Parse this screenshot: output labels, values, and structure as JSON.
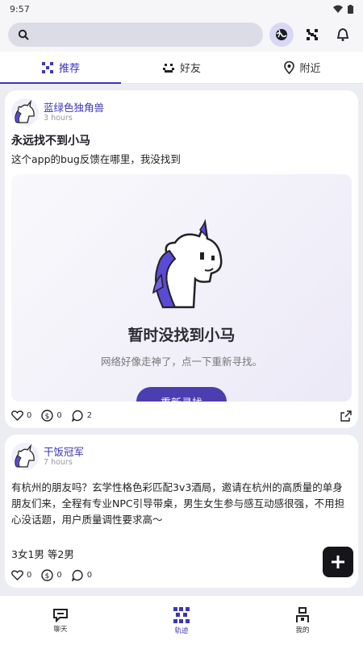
{
  "status_bar": {
    "time": "9:57"
  },
  "search": {
    "placeholder": ""
  },
  "header_icons": [
    "globe-icon",
    "grid-icon",
    "bell-icon"
  ],
  "tabs": [
    {
      "label": "推荐",
      "icon": "sparkle-grid-icon",
      "active": true
    },
    {
      "label": "好友",
      "icon": "smile-face-icon",
      "active": false
    },
    {
      "label": "附近",
      "icon": "location-pin-icon",
      "active": false
    }
  ],
  "posts": [
    {
      "author": "蓝绿色独角兽",
      "time": "3 hours",
      "title": "永远找不到小马",
      "text": "这个app的bug反馈在哪里，我没找到",
      "media": {
        "empty_title": "暂时没找到小马",
        "empty_subtitle": "网络好像走神了，点一下重新寻找。",
        "retry_label": "重新寻找"
      },
      "likes": "0",
      "coins": "0",
      "comments": "2"
    },
    {
      "author": "干饭冠军",
      "time": "7 hours",
      "text": "有杭州的朋友吗？玄学性格色彩匹配3v3酒局，邀请在杭州的高质量的单身朋友们来，全程有专业NPC引导带桌，男生女生参与感互动感很强，不用担心没话题，用户质量调性要求高～",
      "extra": "3女1男 等2男",
      "likes": "0",
      "coins": "0",
      "comments": "0"
    }
  ],
  "bottom_nav": [
    {
      "label": "聊天",
      "icon": "chat-icon",
      "active": false
    },
    {
      "label": "轨迹",
      "icon": "trace-icon",
      "active": true
    },
    {
      "label": "我的",
      "icon": "profile-icon",
      "active": false
    }
  ],
  "colors": {
    "accent": "#3b36b8",
    "background": "#ececf3",
    "fab": "#16161a"
  }
}
